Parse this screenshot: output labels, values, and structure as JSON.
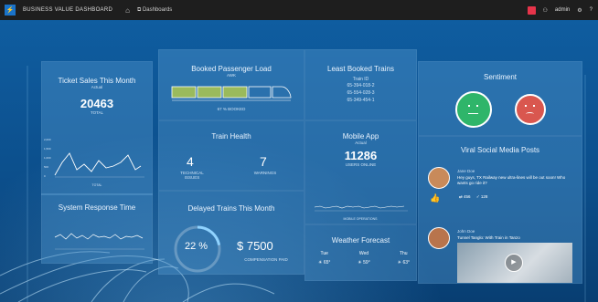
{
  "topbar": {
    "title": "BUSINESS VALUE DASHBOARD",
    "dashboards": "Dashboards",
    "user": "admin",
    "icons": [
      "home-icon",
      "dashboards-icon",
      "alert-icon",
      "user-icon",
      "settings-icon",
      "help-icon"
    ]
  },
  "ticket_sales": {
    "title": "Ticket Sales This Month",
    "subtitle": "Actual",
    "value": "20463",
    "caption": "TOTAL",
    "yticks": [
      "2,000",
      "1,500",
      "1,000",
      "500",
      "0"
    ],
    "xlabel": "TOTAL"
  },
  "system_response": {
    "title": "System Response Time",
    "xlabel": ""
  },
  "booked": {
    "title": "Booked Passenger Load",
    "subtitle": "AWK",
    "caption": "67 % BOOKED",
    "percent": 67
  },
  "least_booked": {
    "title": "Least Booked Trains",
    "header": "Train ID",
    "items": [
      "65-394-018-2",
      "65-554-028-3",
      "65-349-454-1"
    ]
  },
  "train_health": {
    "title": "Train Health",
    "issues_value": "4",
    "issues_label": "TECHNICAL ISSUES",
    "warnings_value": "7",
    "warnings_label": "WARNINGS"
  },
  "delayed": {
    "title": "Delayed Trains This Month",
    "percent_label": "22 %",
    "percent": 22,
    "amount": "$ 7500",
    "amount_label": "COMPENSATION PAID"
  },
  "mobile_app": {
    "title": "Mobile App",
    "subtitle": "Actual",
    "value": "11286",
    "caption": "USERS ONLINE",
    "xlabel": "MOBILE OPERATIONS"
  },
  "weather": {
    "title": "Weather Forecast",
    "days": [
      {
        "day": "Tue",
        "temp": "65°"
      },
      {
        "day": "Wed",
        "temp": "59°"
      },
      {
        "day": "Thu",
        "temp": "63°"
      }
    ]
  },
  "sentiment": {
    "title": "Sentiment",
    "positive_color": "#2fb56a",
    "negative_color": "#d9574f"
  },
  "viral": {
    "title": "Viral Social Media Posts",
    "post1_name": "Jane Doe",
    "post1_text": "Hey guys, TX Railway new ultra-lines will be out soon! Who wants go ride it?",
    "post1_likes": "456",
    "post1_shares": "128",
    "post2_name": "John Doe",
    "post2_text": "Tunnel Tanglo: With Train in Tanzo"
  },
  "colors": {
    "accent": "#1a73c9",
    "tile": "#5096cd",
    "train_car": "#9aba5c"
  }
}
